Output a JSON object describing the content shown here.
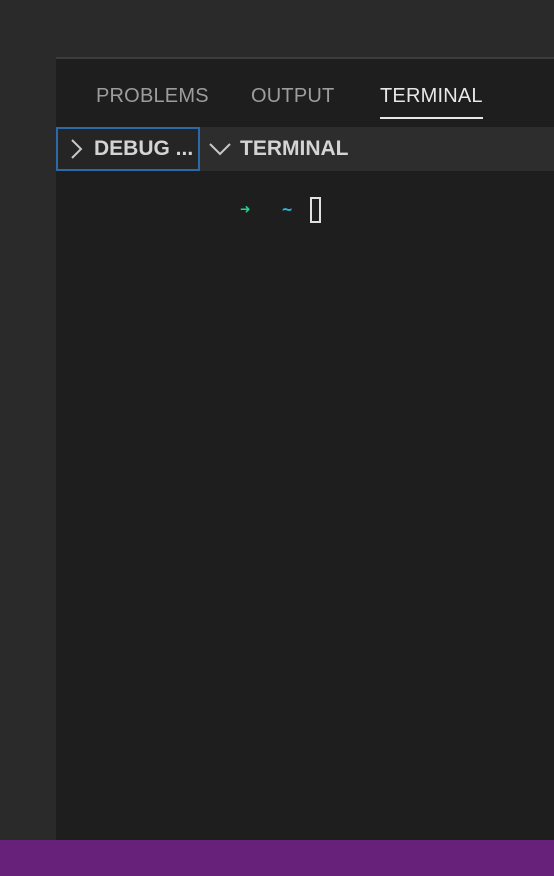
{
  "panel": {
    "tabs": [
      {
        "label": "PROBLEMS",
        "active": false
      },
      {
        "label": "OUTPUT",
        "active": false
      },
      {
        "label": "TERMINAL",
        "active": true
      }
    ]
  },
  "sections": {
    "debug": {
      "label": "DEBUG ...",
      "icon": "chevron-right-icon",
      "expanded": false
    },
    "terminal": {
      "label": "TERMINAL",
      "icon": "chevron-down-icon",
      "expanded": true
    }
  },
  "terminal": {
    "prompt_arrow": "➜",
    "prompt_dir": "~"
  },
  "colors": {
    "status_bar": "#68217a",
    "focus_border": "#2b6aa8",
    "prompt_arrow": "#23d18b",
    "prompt_dir": "#29b8db"
  }
}
